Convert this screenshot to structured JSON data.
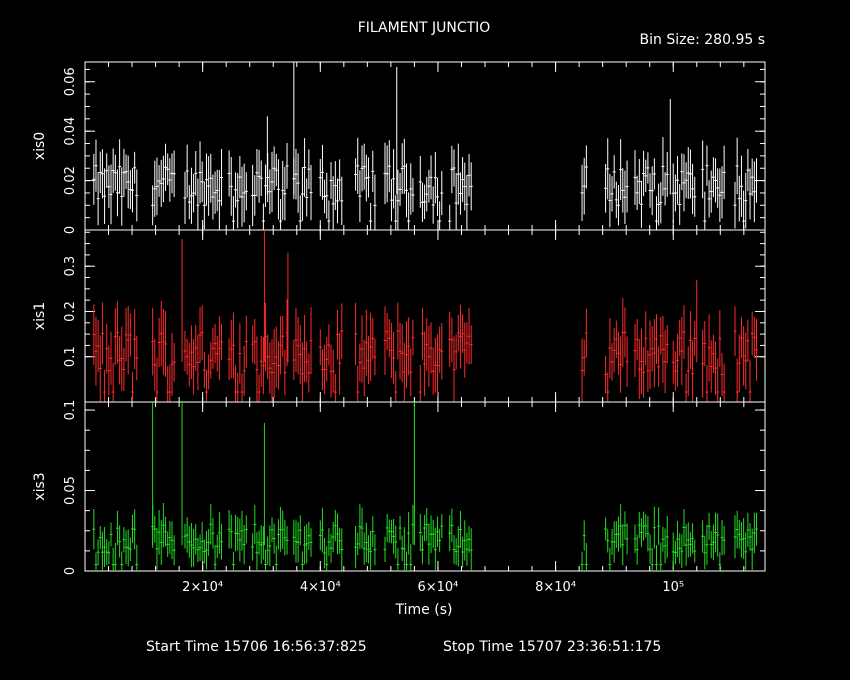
{
  "header": {
    "title": "FILAMENT JUNCTIO",
    "bin_size": "Bin Size: 280.95 s"
  },
  "footer": {
    "start_time": "Start Time 15706 16:56:37:825",
    "stop_time": "Stop Time 15707 23:36:51:175"
  },
  "colors": {
    "background": "#000000",
    "frame": "#ffffff",
    "xis0": "#ffffff",
    "xis1": "#ff2a2a",
    "xis3": "#22dd22"
  },
  "chart_data": {
    "type": "scatter",
    "title": "FILAMENT JUNCTIO",
    "xlabel": "Time (s)",
    "xlim": [
      0,
      115600
    ],
    "x_tick_labels": [
      "2×10⁴",
      "4×10⁴",
      "6×10⁴",
      "8×10⁴",
      "10⁵"
    ],
    "x_tick_values": [
      20000,
      40000,
      60000,
      80000,
      100000
    ],
    "segments": [
      [
        1500,
        9000
      ],
      [
        11500,
        15500
      ],
      [
        17000,
        23500
      ],
      [
        24500,
        27500
      ],
      [
        28500,
        34500
      ],
      [
        35500,
        38500
      ],
      [
        40000,
        44000
      ],
      [
        46000,
        49500
      ],
      [
        51000,
        56000
      ],
      [
        57000,
        61000
      ],
      [
        62000,
        66000
      ],
      [
        84500,
        85500
      ],
      [
        88500,
        92500
      ],
      [
        93500,
        99000
      ],
      [
        100000,
        104000
      ],
      [
        105000,
        109000
      ],
      [
        110500,
        114500
      ]
    ],
    "panels": [
      {
        "name": "xis0",
        "ylabel": "xis0",
        "ylim": [
          0,
          0.068
        ],
        "y_tick_labels": [
          "0",
          "0.02",
          "0.04",
          "0.06"
        ],
        "y_tick_values": [
          0,
          0.02,
          0.04,
          0.06
        ],
        "color": "#ffffff",
        "typical_rate": 0.018,
        "spikes": [
          [
            35500,
            0.068
          ],
          [
            53000,
            0.066
          ],
          [
            31000,
            0.046
          ],
          [
            99500,
            0.053
          ]
        ]
      },
      {
        "name": "xis1",
        "ylabel": "xis1",
        "ylim": [
          0,
          0.38
        ],
        "y_tick_labels": [
          "0.1",
          "0.2",
          "0.3"
        ],
        "y_tick_values": [
          0.1,
          0.2,
          0.3
        ],
        "color": "#ff2a2a",
        "typical_rate": 0.11,
        "spikes": [
          [
            30500,
            0.38
          ],
          [
            16500,
            0.36
          ],
          [
            34500,
            0.33
          ],
          [
            104000,
            0.27
          ]
        ]
      },
      {
        "name": "xis3",
        "ylabel": "xis3",
        "ylim": [
          0,
          0.105
        ],
        "y_tick_labels": [
          "0",
          "0.05",
          "0.1"
        ],
        "y_tick_values": [
          0,
          0.05,
          0.1
        ],
        "color": "#22dd22",
        "typical_rate": 0.02,
        "spikes": [
          [
            11500,
            0.105
          ],
          [
            16500,
            0.105
          ],
          [
            56000,
            0.105
          ],
          [
            30500,
            0.092
          ]
        ]
      }
    ]
  }
}
